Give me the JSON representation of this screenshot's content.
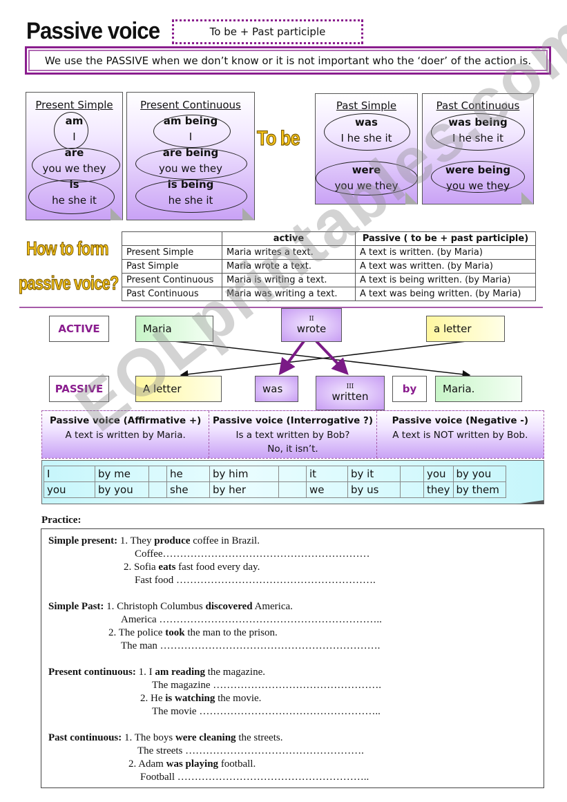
{
  "header": {
    "title": "Passive voice",
    "formula": "To be + Past participle",
    "usage": "We use the PASSIVE when we don’t know or it is not important who the ‘doer’ of the action is."
  },
  "to_be_cards": {
    "label": "To be",
    "present_simple": {
      "title": "Present Simple",
      "groups": [
        {
          "verb": "am",
          "subjects": "I"
        },
        {
          "verb": "are",
          "subjects": "you  we  they"
        },
        {
          "verb": "is",
          "subjects": "he  she  it"
        }
      ]
    },
    "present_continuous": {
      "title": "Present Continuous",
      "groups": [
        {
          "verb": "am being",
          "subjects": "I"
        },
        {
          "verb": "are being",
          "subjects": "you   we   they"
        },
        {
          "verb": "is being",
          "subjects": "he  she  it"
        }
      ]
    },
    "past_simple": {
      "title": "Past Simple",
      "groups": [
        {
          "verb": "was",
          "subjects": "I  he  she  it"
        },
        {
          "verb": "were",
          "subjects": "you  we  they"
        }
      ]
    },
    "past_continuous": {
      "title": "Past Continuous",
      "groups": [
        {
          "verb": "was being",
          "subjects": "I  he  she  it"
        },
        {
          "verb": "were being",
          "subjects": "you  we  they"
        }
      ]
    }
  },
  "how_to_form": {
    "heading_line1": "How to form",
    "heading_line2": "passive voice?",
    "table": {
      "headers": [
        "",
        "active",
        "Passive ( to be + past participle)"
      ],
      "rows": [
        {
          "tense": "Present Simple",
          "active": "Maria writes a text.",
          "passive": "A text is written. (by Maria)"
        },
        {
          "tense": "Past Simple",
          "active": "Maria wrote a text.",
          "passive": "A text was written. (by Maria)"
        },
        {
          "tense": "Present Continuous",
          "active": "Maria is writing a text.",
          "passive": "A text is being written. (by Maria)"
        },
        {
          "tense": "Past Continuous",
          "active": "Maria was writing a text.",
          "passive": "A text was being written. (by Maria)"
        }
      ]
    }
  },
  "diagram": {
    "active_label": "ACTIVE",
    "passive_label": "PASSIVE",
    "active": {
      "subject": "Maria",
      "verb_form": "II",
      "verb": "wrote",
      "object": "a letter"
    },
    "passive": {
      "subject": "A letter",
      "aux": "was",
      "participle_form": "III",
      "participle": "written",
      "by": "by",
      "agent": "Maria."
    },
    "colors": {
      "accent": "#8a1d8e",
      "green": "#c8f5c8",
      "yellow": "#fff7a0",
      "purple": "#c79cf3"
    }
  },
  "rules": [
    {
      "title": "Passive voice (Affirmative +)",
      "lines": [
        "A text is written by Maria."
      ]
    },
    {
      "title": "Passive voice (Interrogative ?)",
      "lines": [
        "Is a text written by Bob?",
        "No, it isn’t."
      ]
    },
    {
      "title": "Passive voice (Negative -)",
      "lines": [
        "A text is NOT written by Bob."
      ]
    }
  ],
  "pronouns": [
    [
      [
        "I",
        "by me"
      ],
      [
        "he",
        "by him"
      ],
      [
        "it",
        "by it"
      ],
      [
        "you",
        "by you"
      ]
    ],
    [
      [
        "you",
        "by you"
      ],
      [
        "she",
        "by her"
      ],
      [
        "we",
        "by us"
      ],
      [
        "they",
        "by them"
      ]
    ]
  ],
  "practice": {
    "label": "Practice:",
    "sections": [
      {
        "title": "Simple present:",
        "items": [
          {
            "num": "1.",
            "pre": "They ",
            "bold": "produce",
            "post": " coffee in Brazil.",
            "answer": "Coffee……………………………………………………"
          },
          {
            "num": "2.",
            "pre": "Sofia ",
            "bold": "eats",
            "post": " fast food every day.",
            "answer": "Fast food …………………………………………………."
          }
        ]
      },
      {
        "title": "Simple Past:",
        "items": [
          {
            "num": "1.",
            "pre": "Christoph Columbus ",
            "bold": "discovered",
            "post": " America.",
            "answer": "America ……………………………………………………….."
          },
          {
            "num": "2.",
            "pre": "The police ",
            "bold": "took",
            "post": " the man to the prison.",
            "answer": "The man ………………………………………………………."
          }
        ]
      },
      {
        "title": "Present continuous:",
        "items": [
          {
            "num": "1.",
            "pre": "I ",
            "bold": "am reading",
            "post": " the magazine.",
            "answer": "The magazine …………………………………………."
          },
          {
            "num": "2.",
            "pre": "He ",
            "bold": "is watching",
            "post": " the movie.",
            "answer": "The movie …………………………………………….."
          }
        ]
      },
      {
        "title": "Past continuous:",
        "items": [
          {
            "num": "1.",
            "pre": "The boys ",
            "bold": "were cleaning",
            "post": " the streets.",
            "answer": "The streets ……………………………………………."
          },
          {
            "num": "2.",
            "pre": "Adam ",
            "bold": "was playing",
            "post": " football.",
            "answer": "Football ……………………………………………….."
          }
        ]
      }
    ]
  },
  "watermark": "EOLprintables.com"
}
